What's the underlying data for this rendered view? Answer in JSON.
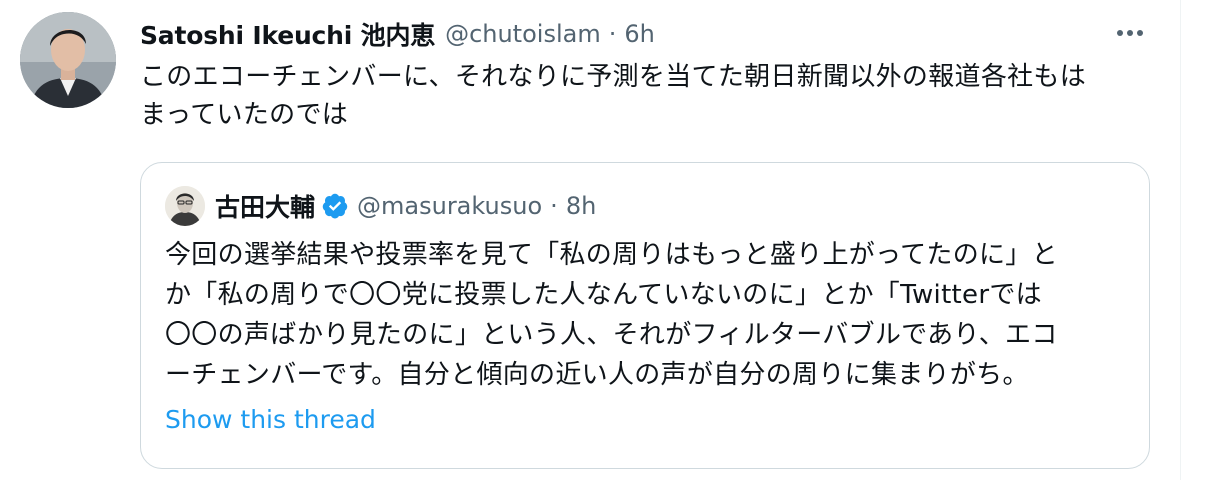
{
  "tweet": {
    "author_name": "Satoshi Ikeuchi 池内恵",
    "handle": "@chutoislam",
    "separator": "·",
    "time": "6h",
    "text_lines": [
      "このエコーチェンバーに、それなりに予測を当てた朝日新聞以外の報道各社もは",
      "まっていたのでは"
    ],
    "more_icon": "more-horizontal-icon"
  },
  "quote": {
    "author_name": "古田大輔",
    "verified_icon": "verified-badge-icon",
    "handle": "@masurakusuo",
    "separator": "·",
    "time": "8h",
    "text_lines": [
      "今回の選挙結果や投票率を見て「私の周りはもっと盛り上がってたのに」と",
      "か「私の周りで〇〇党に投票した人なんていないのに」とか「Twitterでは",
      "〇〇の声ばかり見たのに」という人、それがフィルターバブルであり、エコ",
      "ーチェンバーです。自分と傾向の近い人の声が自分の周りに集まりがち。"
    ],
    "show_thread": "Show this thread"
  },
  "colors": {
    "text_primary": "#0f1419",
    "text_secondary": "#536471",
    "link": "#1d9bf0",
    "border": "#cfd9de",
    "verified": "#1d9bf0"
  }
}
